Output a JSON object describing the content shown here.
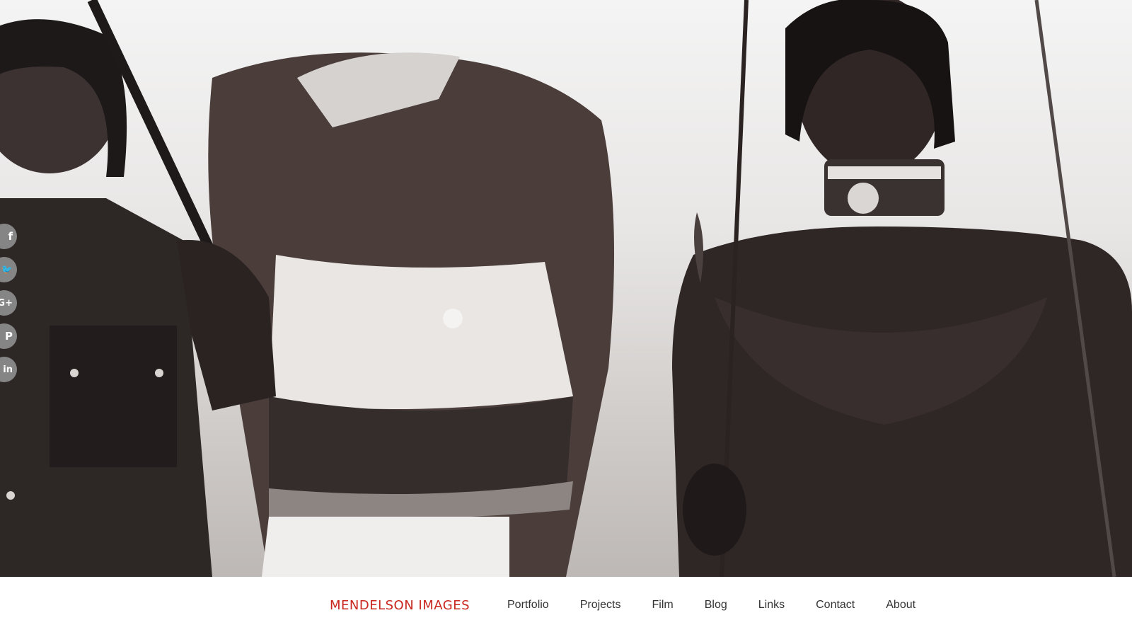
{
  "hero": {
    "image": "black-and-white photograph of warriors with spears and beaded necklaces"
  },
  "share": [
    {
      "icon": "facebook-icon",
      "glyph": "f"
    },
    {
      "icon": "twitter-icon",
      "glyph": "🐦"
    },
    {
      "icon": "google-plus-icon",
      "glyph": "G+"
    },
    {
      "icon": "pinterest-icon",
      "glyph": "P"
    },
    {
      "icon": "linkedin-icon",
      "glyph": "in"
    }
  ],
  "nav": {
    "brand": "MENDELSON IMAGES",
    "brand_color": "#c8261f",
    "links": [
      "Portfolio",
      "Projects",
      "Film",
      "Blog",
      "Links",
      "Contact",
      "About"
    ]
  }
}
